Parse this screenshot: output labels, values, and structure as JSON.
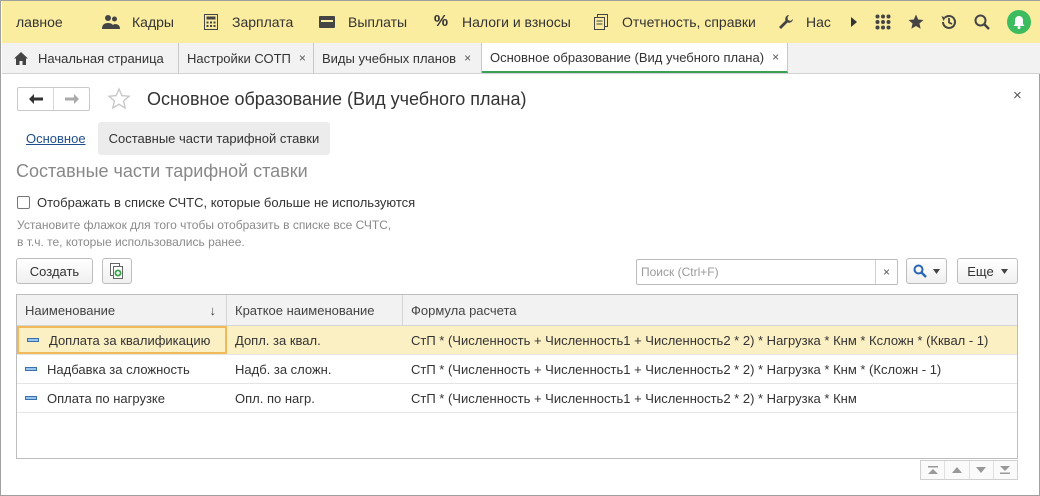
{
  "topbar": {
    "items": [
      {
        "label": "лавное",
        "icon": "none"
      },
      {
        "label": "Кадры",
        "icon": "people-icon"
      },
      {
        "label": "Зарплата",
        "icon": "calculator-icon"
      },
      {
        "label": "Выплаты",
        "icon": "wallet-icon"
      },
      {
        "label": "Налоги и взносы",
        "icon": "percent-icon"
      },
      {
        "label": "Отчетность, справки",
        "icon": "documents-icon"
      },
      {
        "label": "Нас",
        "icon": "wrench-icon"
      }
    ]
  },
  "tabs": [
    {
      "label": "Начальная страница"
    },
    {
      "label": "Настройки СОТП",
      "close": "×"
    },
    {
      "label": "Виды учебных планов",
      "close": "×"
    },
    {
      "label": "Основное образование (Вид учебного плана)",
      "close": "×"
    }
  ],
  "window": {
    "title": "Основное образование (Вид учебного плана)",
    "close": "×"
  },
  "subnav": {
    "link": "Основное",
    "current": "Составные части тарифной ставки"
  },
  "section_title": "Составные части тарифной ставки",
  "checkbox": {
    "label": "Отображать в списке СЧТС, которые больше не используются",
    "checked": false
  },
  "hint": {
    "line1": "Установите флажок для того чтобы отобразить в списке все СЧТС,",
    "line2": "в т.ч. те, которые использовались ранее."
  },
  "toolbar": {
    "create_label": "Создать",
    "search_placeholder": "Поиск (Ctrl+F)",
    "search_clear": "×",
    "more_label": "Еще"
  },
  "table": {
    "columns": [
      "Наименование",
      "Краткое наименование",
      "Формула расчета"
    ],
    "sort_indicator": "↓",
    "rows": [
      {
        "name": "Доплата за квалификацию",
        "short": "Допл. за квал.",
        "formula": "СтП * (Численность + Численность1 + Численность2 * 2) * Нагрузка * Кнм * Ксложн * (Кквал - 1)",
        "selected": true
      },
      {
        "name": "Надбавка за сложность",
        "short": "Надб. за сложн.",
        "formula": "СтП * (Численность + Численность1 + Численность2 * 2) * Нагрузка * Кнм * (Ксложн - 1)",
        "selected": false
      },
      {
        "name": "Оплата по нагрузке",
        "short": "Опл. по нагр.",
        "formula": "СтП * (Численность + Численность1 + Численность2 * 2) * Нагрузка * Кнм",
        "selected": false
      }
    ]
  },
  "colors": {
    "topbar_bg": "#fbeda0",
    "active_tab_underline": "#36a152",
    "selected_row_bg": "#fbefc4",
    "link": "#1f4e8c"
  }
}
